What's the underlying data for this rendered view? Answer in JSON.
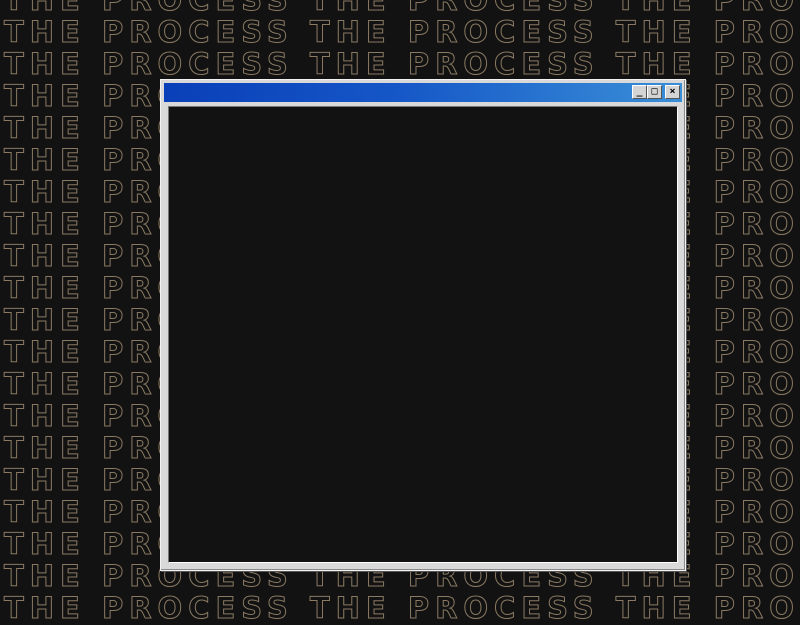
{
  "background": {
    "pattern_text": "THE PROCESS THE PROCESS THE PROCESS THE PROCESS",
    "row_count": 20,
    "text_color": "#8a7a63",
    "background_color": "#121212"
  },
  "window": {
    "title": "",
    "titlebar_gradient": [
      "#0a3fb8",
      "#3a8fd8"
    ],
    "controls": {
      "minimize": "_",
      "maximize": "□",
      "close": "×"
    }
  }
}
